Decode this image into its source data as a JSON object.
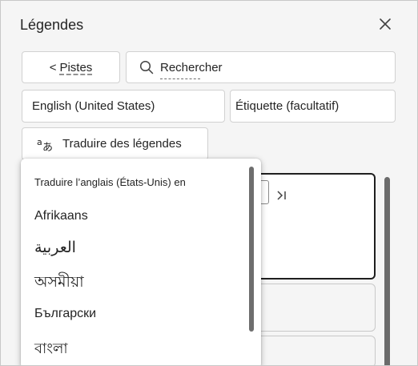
{
  "panel": {
    "title": "Légendes",
    "close_icon": "close-icon"
  },
  "toolbar": {
    "tracks_chevron": "<",
    "tracks_label": "Pistes",
    "search_placeholder": "Rechercher",
    "search_icon": "search-icon"
  },
  "fields": {
    "language_value": "English (United States)",
    "label_placeholder": "Étiquette (facultatif)"
  },
  "translate": {
    "icon": "translate-icon",
    "label": "Traduire des légendes"
  },
  "dropdown": {
    "header": "Traduire l’anglais (États-Unis) en",
    "items": [
      {
        "label": "Afrikaans"
      },
      {
        "label": "العربية"
      },
      {
        "label": "অসমীয়া"
      },
      {
        "label": "Български"
      },
      {
        "label": "বাংলা"
      }
    ]
  },
  "colors": {
    "panel_bg": "#f5f5f5",
    "text": "#242424",
    "border": "#d1d1d1"
  }
}
